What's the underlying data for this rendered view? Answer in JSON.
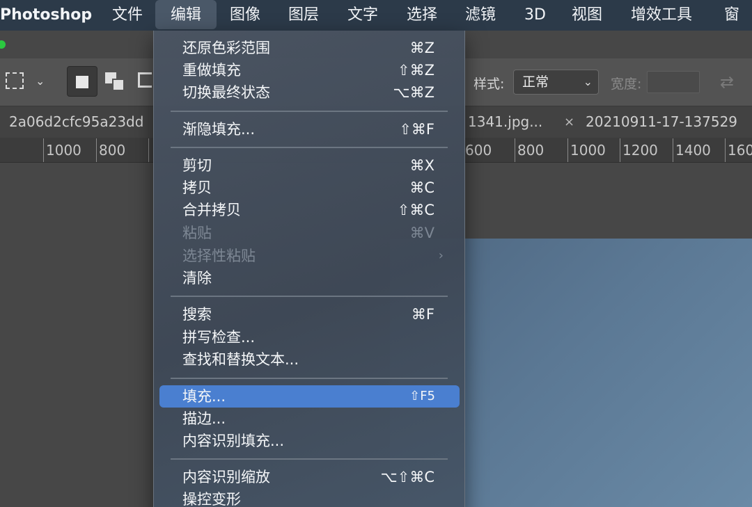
{
  "menubar": {
    "app": "Photoshop",
    "items": [
      "文件",
      "编辑",
      "图像",
      "图层",
      "文字",
      "选择",
      "滤镜",
      "3D",
      "视图",
      "增效工具",
      "窗口"
    ]
  },
  "options": {
    "style_label": "样式:",
    "style_value": "正常",
    "width_label": "宽度:"
  },
  "tabs": {
    "tab1": "2a06d2cfc95a23dd",
    "tab2": "1341.jpg...",
    "tab3": "20210911-17-137529",
    "close": "×"
  },
  "ruler": {
    "left": [
      "1000",
      "800"
    ],
    "right": [
      "600",
      "800",
      "1000",
      "1200",
      "1400",
      "160"
    ]
  },
  "menu": {
    "items": [
      {
        "label": "还原色彩范围",
        "shortcut": "⌘Z"
      },
      {
        "label": "重做填充",
        "shortcut": "⇧⌘Z"
      },
      {
        "label": "切换最终状态",
        "shortcut": "⌥⌘Z"
      },
      {
        "label": "渐隐填充...",
        "shortcut": "⇧⌘F"
      },
      {
        "label": "剪切",
        "shortcut": "⌘X"
      },
      {
        "label": "拷贝",
        "shortcut": "⌘C"
      },
      {
        "label": "合并拷贝",
        "shortcut": "⇧⌘C"
      },
      {
        "label": "粘贴",
        "shortcut": "⌘V"
      },
      {
        "label": "选择性粘贴",
        "shortcut": "›"
      },
      {
        "label": "清除",
        "shortcut": ""
      },
      {
        "label": "搜索",
        "shortcut": "⌘F"
      },
      {
        "label": "拼写检查...",
        "shortcut": ""
      },
      {
        "label": "查找和替换文本...",
        "shortcut": ""
      },
      {
        "label": "填充...",
        "shortcut": "⇧F5"
      },
      {
        "label": "描边...",
        "shortcut": ""
      },
      {
        "label": "内容识别填充...",
        "shortcut": ""
      },
      {
        "label": "内容识别缩放",
        "shortcut": "⌥⇧⌘C"
      },
      {
        "label": "操控变形",
        "shortcut": ""
      }
    ]
  },
  "colors": {
    "menubar": "#2c3a49",
    "highlight": "#4a7fd0",
    "disabled_text": "#7d8794",
    "canvas": "#5b7894"
  }
}
